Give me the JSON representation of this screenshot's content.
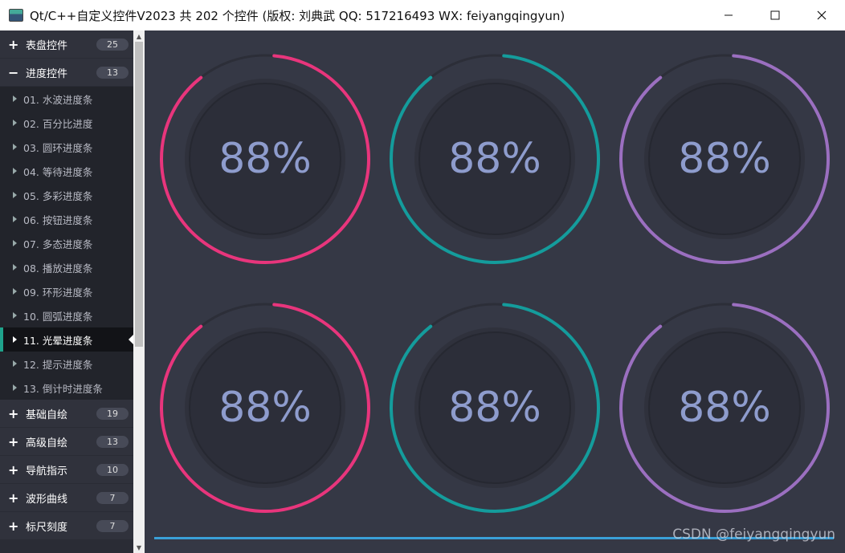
{
  "window": {
    "title": "Qt/C++自定义控件V2023 共 202 个控件 (版权: 刘典武 QQ: 517216493 WX: feiyangqingyun)"
  },
  "sidebar": {
    "groups_top": [
      {
        "sign": "+",
        "label": "表盘控件",
        "count": "25"
      },
      {
        "sign": "−",
        "label": "进度控件",
        "count": "13"
      }
    ],
    "items": [
      {
        "label": "01. 水波进度条"
      },
      {
        "label": "02. 百分比进度"
      },
      {
        "label": "03. 圆环进度条"
      },
      {
        "label": "04. 等待进度条"
      },
      {
        "label": "05. 多彩进度条"
      },
      {
        "label": "06. 按钮进度条"
      },
      {
        "label": "07. 多态进度条"
      },
      {
        "label": "08. 播放进度条"
      },
      {
        "label": "09. 环形进度条"
      },
      {
        "label": "10. 圆弧进度条"
      },
      {
        "label": "11. 光晕进度条"
      },
      {
        "label": "12. 提示进度条"
      },
      {
        "label": "13. 倒计时进度条"
      }
    ],
    "groups_bottom": [
      {
        "sign": "+",
        "label": "基础自绘",
        "count": "19"
      },
      {
        "sign": "+",
        "label": "高级自绘",
        "count": "13"
      },
      {
        "sign": "+",
        "label": "导航指示",
        "count": "10"
      },
      {
        "sign": "+",
        "label": "波形曲线",
        "count": "7"
      },
      {
        "sign": "+",
        "label": "标尺刻度",
        "count": "7"
      }
    ]
  },
  "gauges": [
    {
      "value": "88%",
      "color": "#e8357c"
    },
    {
      "value": "88%",
      "color": "#149c9c"
    },
    {
      "value": "88%",
      "color": "#9b6fc0"
    },
    {
      "value": "88%",
      "color": "#e8357c"
    },
    {
      "value": "88%",
      "color": "#149c9c"
    },
    {
      "value": "88%",
      "color": "#9b6fc0"
    }
  ],
  "watermark": "CSDN @feiyangqingyun",
  "colors": {
    "accent": "#1fa38c",
    "progress_bar": "#3aa0d8",
    "background": "#353845"
  }
}
